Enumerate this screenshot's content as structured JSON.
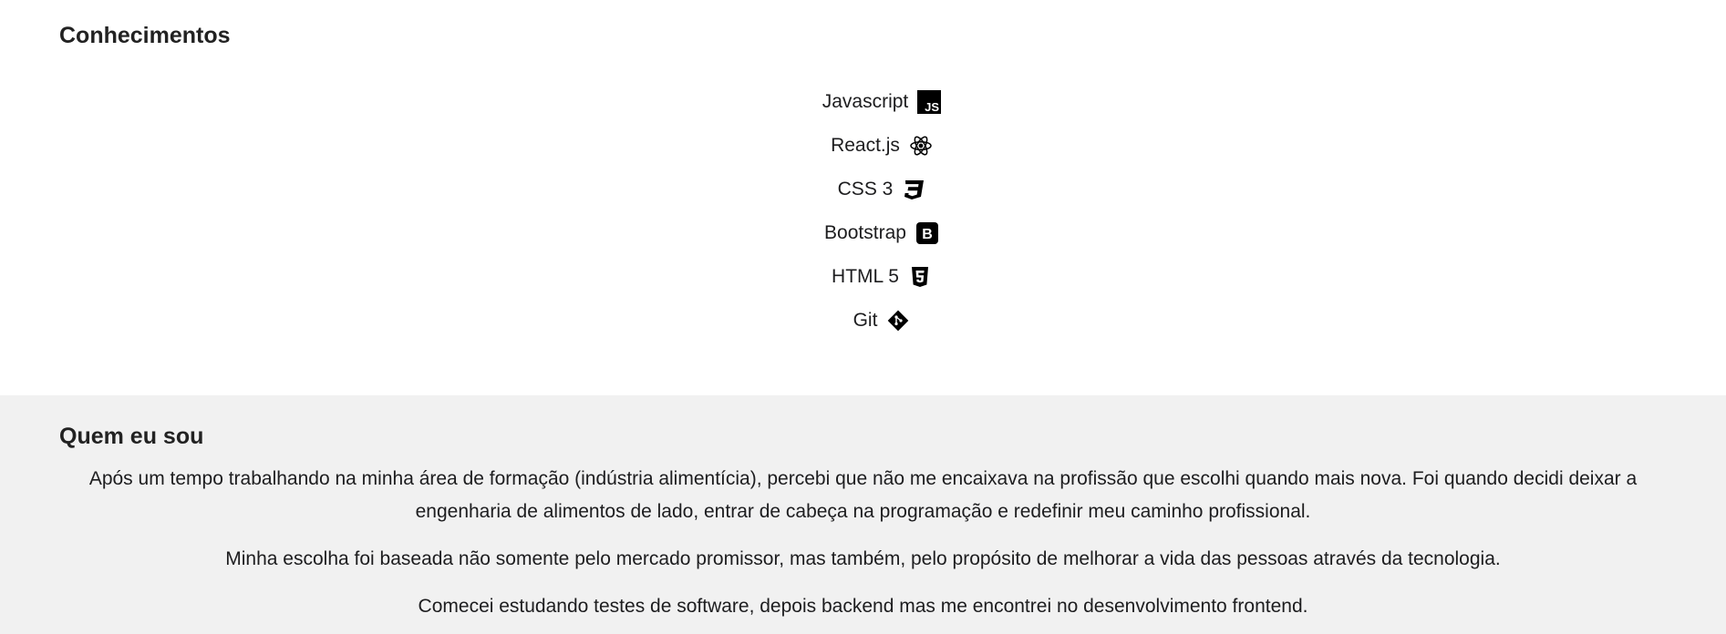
{
  "skills": {
    "title": "Conhecimentos",
    "items": [
      {
        "label": "Javascript",
        "icon": "javascript-icon"
      },
      {
        "label": "React.js",
        "icon": "react-icon"
      },
      {
        "label": "CSS 3",
        "icon": "css3-icon"
      },
      {
        "label": "Bootstrap",
        "icon": "bootstrap-icon"
      },
      {
        "label": "HTML 5",
        "icon": "html5-icon"
      },
      {
        "label": "Git",
        "icon": "git-icon"
      }
    ]
  },
  "about": {
    "title": "Quem eu sou",
    "paragraphs": [
      "Após um tempo trabalhando na minha área de formação (indústria alimentícia), percebi que não me encaixava na profissão que escolhi quando mais nova. Foi quando decidi deixar a engenharia de alimentos de lado, entrar de cabeça na programação e redefinir meu caminho profissional.",
      "Minha escolha foi baseada não somente pelo mercado promissor, mas também, pelo propósito de melhorar a vida das pessoas através da tecnologia.",
      "Comecei estudando testes de software, depois backend mas me encontrei no desenvolvimento frontend."
    ]
  },
  "colors": {
    "text": "#1d1d1f",
    "about_background": "#f1f1f1",
    "page_background": "#ffffff"
  }
}
